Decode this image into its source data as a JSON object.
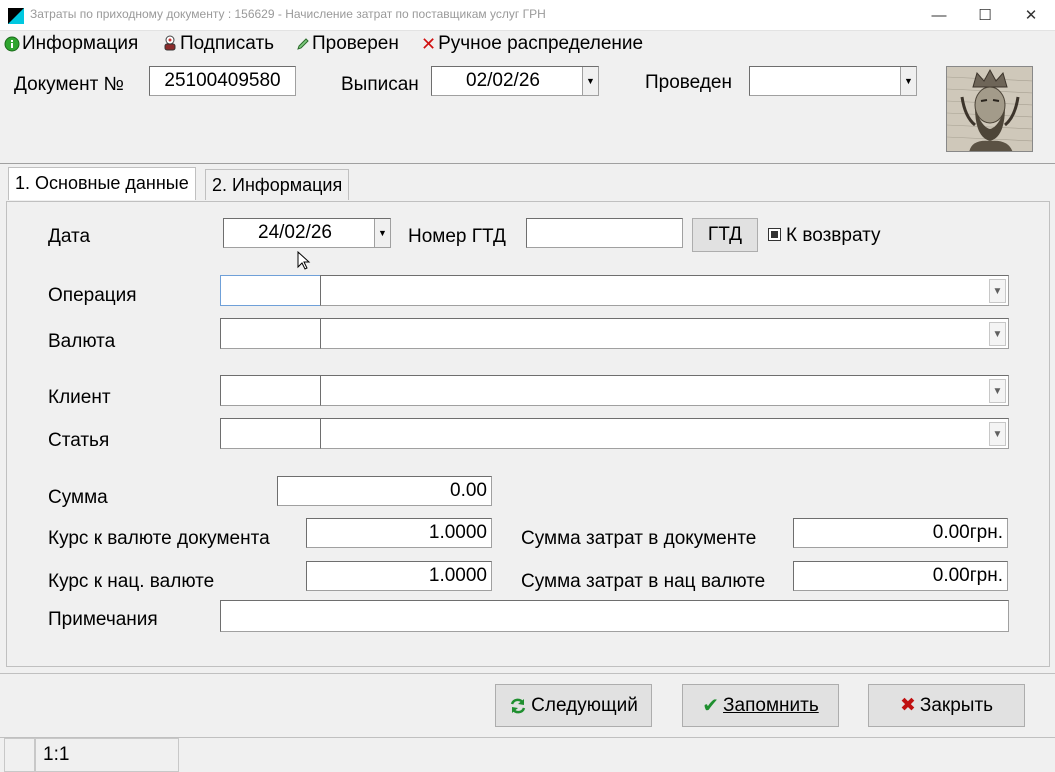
{
  "window": {
    "title": "Затраты по приходному документу : 156629 - Начисление затрат по поставщикам услуг ГРН",
    "minimize_glyph": "—",
    "maximize_glyph": "☐",
    "close_glyph": "✕"
  },
  "toolbar": {
    "items": [
      {
        "label": "Информация",
        "icon": "info-icon",
        "color": "#1a9a1a"
      },
      {
        "label": "Подписать",
        "icon": "stamp-icon",
        "color": "#7a2020"
      },
      {
        "label": "Проверен",
        "icon": "pencil-icon",
        "color": "#2a7a2a"
      },
      {
        "label": "Ручное распределение",
        "icon": "red-x-icon",
        "color": "#d01010"
      }
    ]
  },
  "header": {
    "doc_number_label": "Документ №",
    "doc_number": "25100409580",
    "issued_label": "Выписан",
    "issued_date": "02/02/26",
    "posted_label": "Проведен",
    "posted_value": ""
  },
  "tabs": [
    {
      "label": "1. Основные данные",
      "active": true
    },
    {
      "label": "2. Информация",
      "active": false
    }
  ],
  "form": {
    "date_label": "Дата",
    "date_value": "24/02/26",
    "gtd_number_label": "Номер ГТД",
    "gtd_number_value": "",
    "gtd_button": "ГТД",
    "return_label": "К возврату",
    "operation_label": "Операция",
    "currency_label": "Валюта",
    "client_label": "Клиент",
    "article_label": "Статья",
    "sum_label": "Сумма",
    "sum_value": "0.00",
    "rate_doc_label": "Курс к валюте документа",
    "rate_doc_value": "1.0000",
    "rate_nat_label": "Курс к нац. валюте",
    "rate_nat_value": "1.0000",
    "cost_doc_label": "Сумма затрат в документе",
    "cost_doc_value": "0.00грн.",
    "cost_nat_label": "Сумма затрат в нац валюте",
    "cost_nat_value": "0.00грн.",
    "notes_label": "Примечания",
    "notes_value": ""
  },
  "buttons": {
    "next": "Следующий",
    "save": "Запомнить",
    "close": "Закрыть"
  },
  "status": {
    "position": "1:1"
  }
}
